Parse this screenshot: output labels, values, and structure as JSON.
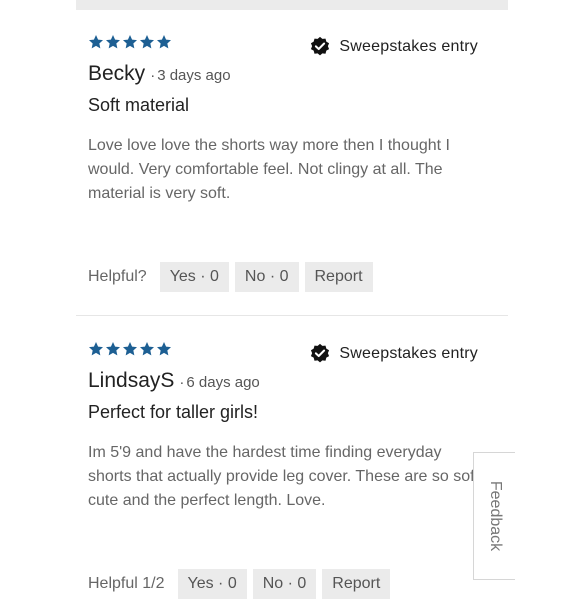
{
  "icons": {
    "star": "star-icon",
    "sweepstakes": "check-badge-icon"
  },
  "colors": {
    "star": "#1d5f93",
    "badge": "#111111",
    "button_bg": "#ebebeb"
  },
  "reviews": [
    {
      "rating": 5,
      "badge_label": "Sweepstakes entry",
      "author": "Becky",
      "separator": "·",
      "date": "3 days ago",
      "title": "Soft material",
      "body": "Love love love the shorts way more then I thought I would. Very comfortable feel. Not clingy at all. The material is very soft.",
      "helpful_label": "Helpful?",
      "yes_label": "Yes · 0",
      "no_label": "No · 0",
      "report_label": "Report"
    },
    {
      "rating": 5,
      "badge_label": "Sweepstakes entry",
      "author": "LindsayS",
      "separator": "·",
      "date": "6 days ago",
      "title": "Perfect for taller girls!",
      "body": "Im 5'9 and have the hardest time finding everyday shorts that actually provide leg cover. These are so soft, cute and the perfect length. Love.",
      "helpful_label": "Helpful 1/2",
      "yes_label": "Yes · 0",
      "no_label": "No · 0",
      "report_label": "Report"
    }
  ],
  "feedback_label": "Feedback"
}
